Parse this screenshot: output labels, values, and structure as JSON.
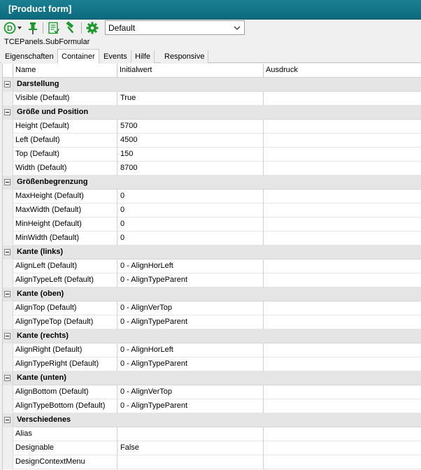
{
  "window": {
    "title": "[Product form]"
  },
  "toolbar": {
    "icons": [
      "circle-d-icon",
      "pin-icon",
      "list-icon",
      "hammer-icon",
      "gear-icon"
    ],
    "view_select": {
      "value": "Default"
    },
    "accent": "#1a9a2a"
  },
  "path_label": "TCEPanels.SubFormular",
  "tabs": [
    {
      "label": "Eigenschaften"
    },
    {
      "label": "Container",
      "active": true
    },
    {
      "label": "Events"
    },
    {
      "label": "Hilfe"
    },
    {
      "label": "Responsive"
    }
  ],
  "grid": {
    "columns": [
      "Name",
      "Initialwert",
      "Ausdruck"
    ],
    "rows": [
      {
        "type": "category",
        "label": "Darstellung"
      },
      {
        "type": "prop",
        "name": "Visible (Default)",
        "value": "True",
        "expr": ""
      },
      {
        "type": "category",
        "label": "Größe und Position"
      },
      {
        "type": "prop",
        "name": "Height (Default)",
        "value": "5700",
        "expr": ""
      },
      {
        "type": "prop",
        "name": "Left (Default)",
        "value": "4500",
        "expr": ""
      },
      {
        "type": "prop",
        "name": "Top (Default)",
        "value": "150",
        "expr": ""
      },
      {
        "type": "prop",
        "name": "Width (Default)",
        "value": "8700",
        "expr": ""
      },
      {
        "type": "category",
        "label": "Größenbegrenzung"
      },
      {
        "type": "prop",
        "name": "MaxHeight (Default)",
        "value": "0",
        "expr": ""
      },
      {
        "type": "prop",
        "name": "MaxWidth (Default)",
        "value": "0",
        "expr": ""
      },
      {
        "type": "prop",
        "name": "MinHeight (Default)",
        "value": "0",
        "expr": ""
      },
      {
        "type": "prop",
        "name": "MinWidth (Default)",
        "value": "0",
        "expr": ""
      },
      {
        "type": "category",
        "label": "Kante (links)"
      },
      {
        "type": "prop",
        "name": "AlignLeft (Default)",
        "value": "0 - AlignHorLeft",
        "expr": ""
      },
      {
        "type": "prop",
        "name": "AlignTypeLeft (Default)",
        "value": "0 - AlignTypeParent",
        "expr": ""
      },
      {
        "type": "category",
        "label": "Kante (oben)"
      },
      {
        "type": "prop",
        "name": "AlignTop (Default)",
        "value": "0 - AlignVerTop",
        "expr": ""
      },
      {
        "type": "prop",
        "name": "AlignTypeTop (Default)",
        "value": "0 - AlignTypeParent",
        "expr": ""
      },
      {
        "type": "category",
        "label": "Kante (rechts)"
      },
      {
        "type": "prop",
        "name": "AlignRight (Default)",
        "value": "0 - AlignHorLeft",
        "expr": ""
      },
      {
        "type": "prop",
        "name": "AlignTypeRight (Default)",
        "value": "0 - AlignTypeParent",
        "expr": ""
      },
      {
        "type": "category",
        "label": "Kante (unten)"
      },
      {
        "type": "prop",
        "name": "AlignBottom (Default)",
        "value": "0 - AlignVerTop",
        "expr": ""
      },
      {
        "type": "prop",
        "name": "AlignTypeBottom (Default)",
        "value": "0 - AlignTypeParent",
        "expr": ""
      },
      {
        "type": "category",
        "label": "Verschiedenes"
      },
      {
        "type": "prop",
        "name": "Alias",
        "value": "",
        "expr": ""
      },
      {
        "type": "prop",
        "name": "Designable",
        "value": "False",
        "expr": ""
      },
      {
        "type": "prop",
        "name": "DesignContextMenu",
        "value": "",
        "expr": ""
      }
    ]
  }
}
